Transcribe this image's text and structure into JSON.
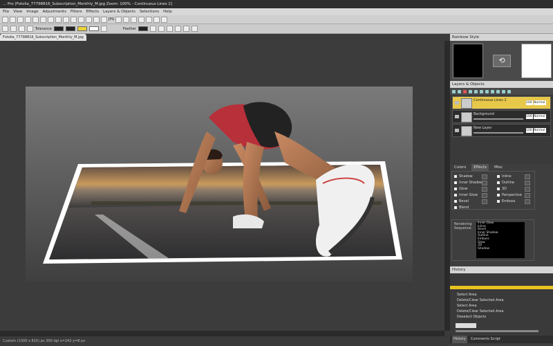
{
  "window": {
    "title": "... Pro [Fotolia_77798816_Subscription_Monthly_M.jpg Zoom: 100% - Continuous Lines 2]"
  },
  "menu": [
    "File",
    "View",
    "Image",
    "Adjustments",
    "Filters",
    "Effects",
    "Layers & Objects",
    "Selections",
    "Help"
  ],
  "toolbar": {
    "tolerance_label": "Tolerance",
    "feather_label": "Feather",
    "format_label": "JPG"
  },
  "document": {
    "tab_label": "Fotolia_77798816_Subscription_Monthly_M.jpg"
  },
  "status": {
    "text": "Custom (1300 x 815) px 300 dpi   x=242 y=8 px"
  },
  "panels": {
    "rainbow": {
      "title": "Rainbow Style"
    },
    "layers": {
      "title": "Layers & Objects",
      "items": [
        {
          "name": "Continuous Lines 2",
          "opacity": "100",
          "blend": "Normal",
          "selected": true
        },
        {
          "name": "Background",
          "opacity": "100",
          "blend": "Normal",
          "selected": false
        },
        {
          "name": "New Layer",
          "opacity": "100",
          "blend": "Normal",
          "selected": false
        }
      ]
    },
    "effects": {
      "tabs": [
        "Colors",
        "Effects",
        "Misc"
      ],
      "left": [
        "Shadow",
        "Inner Shadow",
        "Glow",
        "Inner Glow",
        "Bevel",
        "Blend"
      ],
      "right": [
        "Inline",
        "Outline",
        "3D",
        "Perspective",
        "Emboss"
      ],
      "rendering_label": "Rendering Sequence",
      "rendering": [
        "Inner Glow",
        "Inline",
        "Bevel",
        "Inner Shadow",
        "Outline",
        "Emboss",
        "Glow",
        "3D",
        "Shadow"
      ]
    },
    "history": {
      "title": "History",
      "items": [
        "Select Area",
        "Delete/Clear Selected Area",
        "Select Area",
        "Delete/Clear Selected Area",
        "Deselect Objects"
      ]
    }
  },
  "bottom_tabs": [
    "History",
    "Comments Script"
  ]
}
